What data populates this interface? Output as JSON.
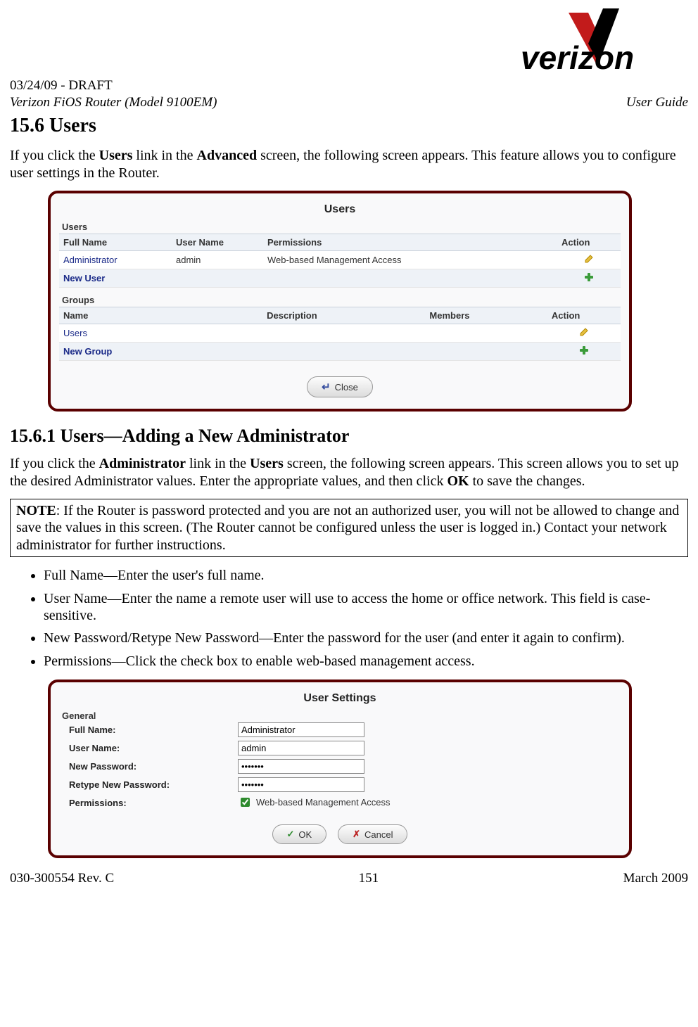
{
  "header": {
    "draft": "03/24/09 - DRAFT",
    "product": "Verizon FiOS Router (Model 9100EM)",
    "guide": "User Guide",
    "logo_text": "verizon"
  },
  "section": {
    "number_title": "15.6   Users",
    "intro_pre": "If you click the ",
    "intro_link1": "Users",
    "intro_mid1": " link in the ",
    "intro_link2": "Advanced",
    "intro_post": " screen, the following screen appears. This feature allows you to configure user settings in the Router."
  },
  "panel1": {
    "title": "Users",
    "users_label": "Users",
    "users_headers": {
      "c1": "Full Name",
      "c2": "User Name",
      "c3": "Permissions",
      "c4": "Action"
    },
    "users_rows": [
      {
        "full": "Administrator",
        "user": "admin",
        "perm": "Web-based Management Access",
        "action": "edit"
      },
      {
        "full": "New User",
        "user": "",
        "perm": "",
        "action": "add"
      }
    ],
    "groups_label": "Groups",
    "groups_headers": {
      "c1": "Name",
      "c2": "Description",
      "c3": "Members",
      "c4": "Action"
    },
    "groups_rows": [
      {
        "name": "Users",
        "desc": "",
        "members": "",
        "action": "edit"
      },
      {
        "name": "New Group",
        "desc": "",
        "members": "",
        "action": "add"
      }
    ],
    "close_label": "Close"
  },
  "subsection": {
    "heading": "15.6.1 Users—Adding a New Administrator",
    "p_pre": "If you click the ",
    "p_b1": "Administrator",
    "p_mid1": " link in the ",
    "p_b2": "Users",
    "p_mid2": " screen, the following screen appears. This screen allows you to set up the desired Administrator values. Enter the appropriate values, and then click ",
    "p_b3": "OK",
    "p_post": " to save the changes."
  },
  "note": {
    "label": "NOTE",
    "text": ": If the Router is password protected and you are not an authorized user, you will not be allowed to change and save the values in this screen. (The Router cannot be configured unless the user is logged in.) Contact your network administrator for further instructions."
  },
  "bullets": [
    "Full Name—Enter the user's full name.",
    "User Name—Enter the name a remote user will use to access the home or office network. This field is case-sensitive.",
    "New Password/Retype New Password—Enter the password for the user (and enter it again to confirm).",
    "Permissions—Click the check box to enable web-based management access."
  ],
  "panel2": {
    "title": "User Settings",
    "general": "General",
    "labels": {
      "full": "Full Name:",
      "user": "User Name:",
      "newpw": "New Password:",
      "retype": "Retype New Password:",
      "perm": "Permissions:"
    },
    "values": {
      "full": "Administrator",
      "user": "admin",
      "newpw": "•••••••",
      "retype": "•••••••",
      "perm": "Web-based Management Access"
    },
    "ok": "OK",
    "cancel": "Cancel"
  },
  "footer": {
    "left": "030-300554 Rev. C",
    "center": "151",
    "right": "March 2009"
  }
}
